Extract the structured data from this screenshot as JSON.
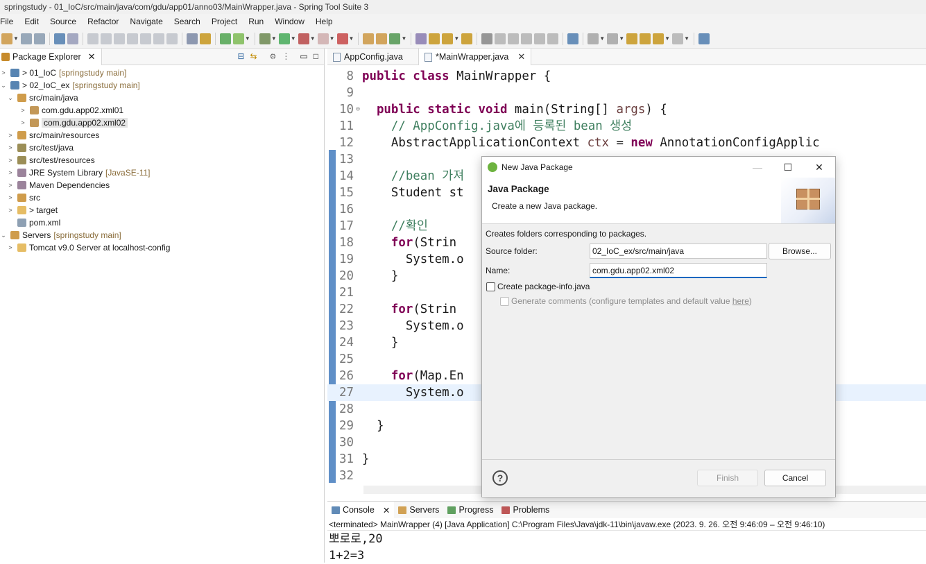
{
  "window": {
    "title": "springstudy - 01_IoC/src/main/java/com/gdu/app01/anno03/MainWrapper.java - Spring Tool Suite 3"
  },
  "menu": [
    "File",
    "Edit",
    "Source",
    "Refactor",
    "Navigate",
    "Search",
    "Project",
    "Run",
    "Window",
    "Help"
  ],
  "package_explorer": {
    "tab_label": "Package Explorer",
    "items": [
      {
        "label": "01_IoC",
        "prefix": "> ",
        "deco": "[springstudy main]"
      },
      {
        "label": "02_IoC_ex",
        "prefix": "> ",
        "deco": "[springstudy main]"
      },
      {
        "label": "src/main/java"
      },
      {
        "label": "com.gdu.app02.xml01"
      },
      {
        "label": "com.gdu.app02.xml02"
      },
      {
        "label": "src/main/resources"
      },
      {
        "label": "src/test/java"
      },
      {
        "label": "src/test/resources"
      },
      {
        "label": "JRE System Library",
        "deco": "[JavaSE-11]"
      },
      {
        "label": "Maven Dependencies"
      },
      {
        "label": "src"
      },
      {
        "label": "target",
        "prefix": "> "
      },
      {
        "label": "pom.xml"
      },
      {
        "label": "Servers",
        "deco": "[springstudy main]"
      },
      {
        "label": "Tomcat v9.0 Server at localhost-config"
      }
    ]
  },
  "editor": {
    "tabs": [
      {
        "label": "AppConfig.java"
      },
      {
        "label": "*MainWrapper.java"
      }
    ],
    "lines": [
      {
        "n": "8",
        "html": "<span class='kw'>public class</span> MainWrapper {"
      },
      {
        "n": "9",
        "html": ""
      },
      {
        "n": "10",
        "html": "  <span class='kw'>public static void</span> main(String[] <span class='var'>args</span>) {"
      },
      {
        "n": "11",
        "html": "    <span class='cm'>// AppConfig.java에 등록된 bean 생성</span>"
      },
      {
        "n": "12",
        "html": "    AbstractApplicationContext <span class='var'>ctx</span> = <span class='kw'>new</span> AnnotationConfigApplic"
      },
      {
        "n": "13",
        "html": ""
      },
      {
        "n": "14",
        "html": "    <span class='cm'>//bean 가져</span>"
      },
      {
        "n": "15",
        "html": "    Student st                                <span class='kw'>.class</span>);"
      },
      {
        "n": "16",
        "html": ""
      },
      {
        "n": "17",
        "html": "    <span class='cm'>//확인</span>"
      },
      {
        "n": "18",
        "html": "    <span class='kw'>for</span>(Strin"
      },
      {
        "n": "19",
        "html": "      System.o"
      },
      {
        "n": "20",
        "html": "    }"
      },
      {
        "n": "21",
        "html": ""
      },
      {
        "n": "22",
        "html": "    <span class='kw'>for</span>(Strin"
      },
      {
        "n": "23",
        "html": "      System.o"
      },
      {
        "n": "24",
        "html": "    }"
      },
      {
        "n": "25",
        "html": ""
      },
      {
        "n": "26",
        "html": "    <span class='kw'>for</span>(Map.En                               tFriends()."
      },
      {
        "n": "27",
        "html": "      System.o                               y.getValue"
      },
      {
        "n": "28",
        "html": ""
      },
      {
        "n": "29",
        "html": "  }"
      },
      {
        "n": "30",
        "html": ""
      },
      {
        "n": "31",
        "html": "}"
      },
      {
        "n": "32",
        "html": ""
      }
    ]
  },
  "console": {
    "tabs": [
      "Console",
      "Servers",
      "Progress",
      "Problems"
    ],
    "status": "<terminated> MainWrapper (4) [Java Application] C:\\Program Files\\Java\\jdk-11\\bin\\javaw.exe  (2023. 9. 26. 오전 9:46:09 – 오전 9:46:10)",
    "output": [
      "뽀로로,20",
      "1+2=3"
    ]
  },
  "dialog": {
    "title": "New Java Package",
    "heading": "Java Package",
    "subheading": "Create a new Java package.",
    "description": "Creates folders corresponding to packages.",
    "source_folder_label": "Source folder:",
    "source_folder_value": "02_IoC_ex/src/main/java",
    "browse_label": "Browse...",
    "name_label": "Name:",
    "name_value": "com.gdu.app02.xml02",
    "create_info_label": "Create package-info.java",
    "generate_comments_label": "Generate comments (configure templates and default value ",
    "here_link": "here",
    "generate_comments_suffix": ")",
    "finish_label": "Finish",
    "cancel_label": "Cancel",
    "help_glyph": "?"
  },
  "colors": {
    "keyword": "#7f0055",
    "comment": "#3f7f5f",
    "accent": "#0067c0"
  }
}
